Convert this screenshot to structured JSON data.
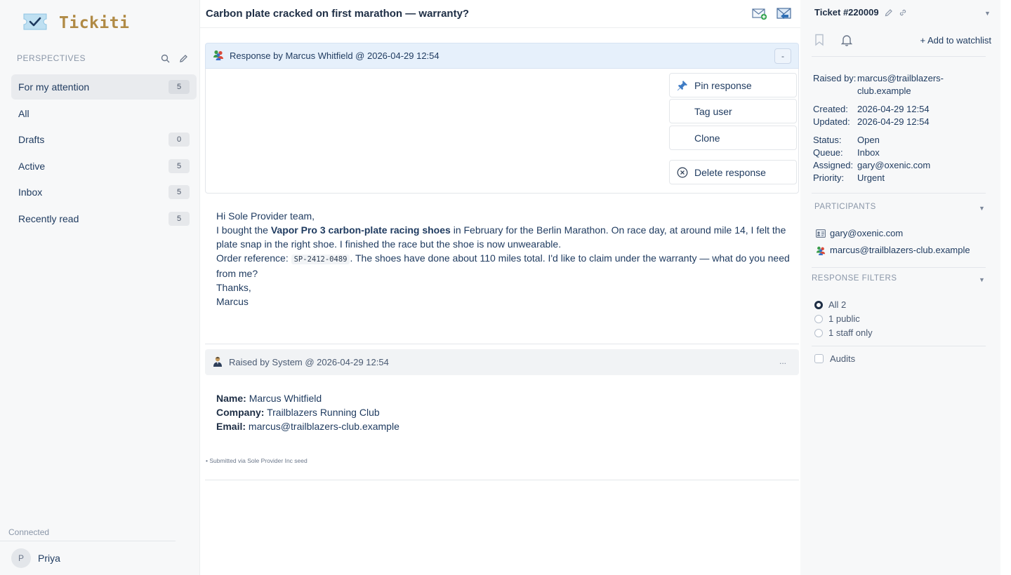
{
  "app": {
    "name": "Tickiti"
  },
  "sidebar": {
    "section_label": "PERSPECTIVES",
    "items": [
      {
        "label": "For my attention",
        "count": "5",
        "active": true
      },
      {
        "label": "All",
        "count": null
      },
      {
        "label": "Drafts",
        "count": "0"
      },
      {
        "label": "Active",
        "count": "5"
      },
      {
        "label": "Inbox",
        "count": "5"
      },
      {
        "label": "Recently read",
        "count": "5"
      }
    ],
    "connection_status": "Connected",
    "user": {
      "initial": "P",
      "name": "Priya"
    }
  },
  "ticket": {
    "title": "Carbon plate cracked on first marathon — warranty?"
  },
  "response": {
    "header": "Response by Marcus Whitfield @ 2026-04-29 12:54",
    "collapse_label": "-",
    "actions": {
      "pin": "Pin response",
      "tag": "Tag user",
      "clone": "Clone",
      "delete": "Delete response"
    },
    "body": {
      "greeting": "Hi Sole Provider team,",
      "p1_pre": "I bought the ",
      "p1_bold": "Vapor Pro 3 carbon-plate racing shoes",
      "p1_post": " in February for the Berlin Marathon. On race day, at around mile 14, I felt the plate snap in the right shoe. I finished the race but the shoe is now unwearable.",
      "p2_pre": "Order reference: ",
      "p2_code": "SP-2412-0489",
      "p2_post": ". The shoes have done about 110 miles total. I'd like to claim under the warranty — what do you need from me?",
      "signoff": "Thanks,",
      "name": "Marcus"
    }
  },
  "system_entry": {
    "header": "Raised by System @ 2026-04-29 12:54",
    "more_label": "...",
    "fields": [
      {
        "label": "Name:",
        "value": "Marcus Whitfield"
      },
      {
        "label": "Company:",
        "value": "Trailblazers Running Club"
      },
      {
        "label": "Email:",
        "value": "marcus@trailblazers-club.example"
      }
    ],
    "footnote": "• Submitted via Sole Provider Inc seed"
  },
  "details": {
    "ticket_number": "Ticket #220009",
    "watchlist_label": "+ Add to watchlist",
    "raised_by_label": "Raised by:",
    "raised_by_value": "marcus@trailblazers-club.example",
    "created_label": "Created:",
    "created_value": "2026-04-29 12:54",
    "updated_label": "Updated:",
    "updated_value": "2026-04-29 12:54",
    "status_label": "Status:",
    "status_value": "Open",
    "queue_label": "Queue:",
    "queue_value": "Inbox",
    "assigned_label": "Assigned:",
    "assigned_value": "gary@oxenic.com",
    "priority_label": "Priority:",
    "priority_value": "Urgent"
  },
  "participants": {
    "label": "PARTICIPANTS",
    "items": [
      "gary@oxenic.com",
      "marcus@trailblazers-club.example"
    ]
  },
  "filters": {
    "label": "RESPONSE FILTERS",
    "options": [
      "All 2",
      "1 public",
      "1 staff only"
    ],
    "selected": 0,
    "audits_label": "Audits"
  },
  "colors": {
    "accent": "#1e3a5f",
    "logo": "#b08a45",
    "response_header": "#e6f0fb"
  }
}
